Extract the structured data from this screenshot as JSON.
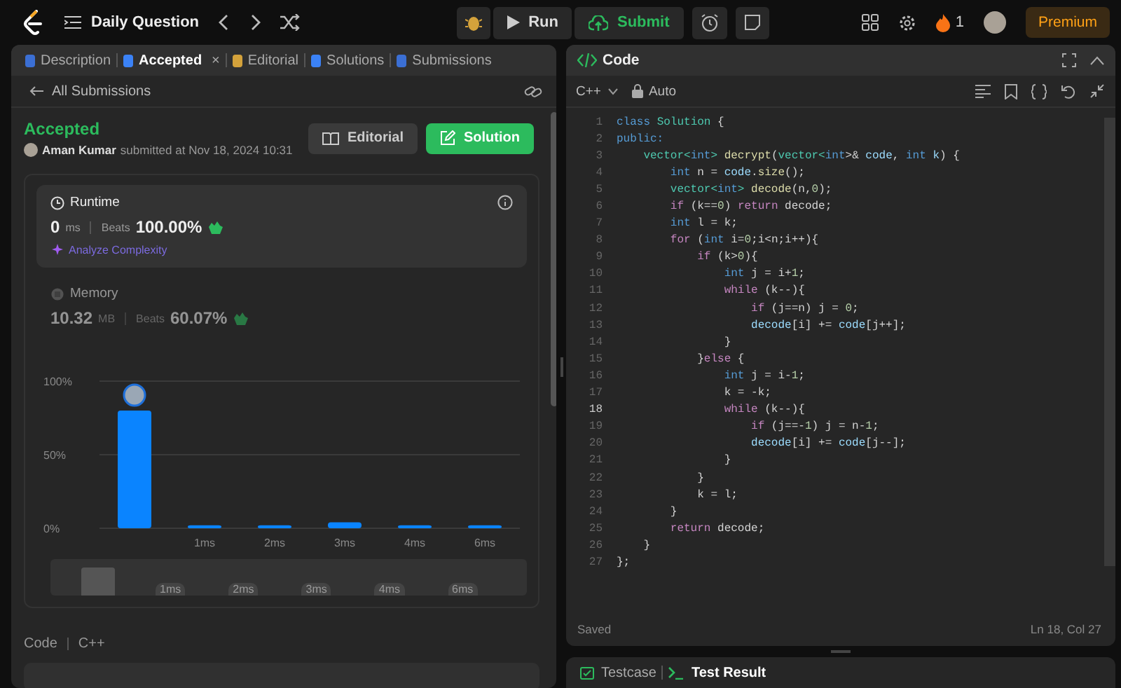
{
  "top_bar": {
    "nav_title": "Daily Question",
    "run": "Run",
    "submit": "Submit",
    "streak": "1",
    "premium": "Premium"
  },
  "left_tabs": [
    {
      "label": "Description",
      "selected": false,
      "closable": false,
      "color": "#3b6fd4"
    },
    {
      "label": "Accepted",
      "selected": true,
      "closable": true,
      "close": "×",
      "color": "#3b82f6"
    },
    {
      "label": "Editorial",
      "selected": false,
      "closable": false,
      "color": "#d4a23b"
    },
    {
      "label": "Solutions",
      "selected": false,
      "closable": false,
      "color": "#3b82f6"
    },
    {
      "label": "Submissions",
      "selected": false,
      "closable": false,
      "color": "#3b6fd4"
    }
  ],
  "back_link": "All Submissions",
  "submission": {
    "status": "Accepted",
    "author": "Aman Kumar",
    "submitted": "submitted at Nov 18, 2024 10:31",
    "editorial_button": "Editorial",
    "solution_button": "Solution"
  },
  "metrics": [
    {
      "kind": "runtime",
      "title": "Runtime",
      "selected": true,
      "value": "0",
      "unit": "ms",
      "beats_label": "Beats",
      "beats": "100.00%",
      "analyze": "Analyze Complexity"
    },
    {
      "kind": "memory",
      "title": "Memory",
      "selected": false,
      "value": "10.32",
      "unit": "MB",
      "beats_label": "Beats",
      "beats": "60.07%"
    }
  ],
  "chart_data": {
    "type": "bar",
    "categories": [
      null,
      "1ms",
      "2ms",
      "3ms",
      "4ms",
      "6ms"
    ],
    "values": [
      80,
      2,
      2,
      4,
      2,
      2
    ],
    "ylim": [
      0,
      100
    ],
    "yticks": [
      {
        "value": 0,
        "label": "0%"
      },
      {
        "value": 50,
        "label": "50%"
      },
      {
        "value": 100,
        "label": "100%"
      }
    ]
  },
  "overview_labels": [
    "1ms",
    "2ms",
    "3ms",
    "4ms",
    "6ms"
  ],
  "code_section": {
    "label": "Code",
    "language": "C++"
  },
  "editor": {
    "title": "Code",
    "language": "C++",
    "mode": "Auto",
    "status": "Saved",
    "cursor": "Ln 18, Col 27",
    "lines": [
      {
        "n": "1",
        "current": false,
        "seg": [
          {
            "text": "class ",
            "kind": "kw"
          },
          {
            "text": "Solution",
            "kind": "type"
          },
          {
            "text": " {",
            "kind": "p"
          }
        ]
      },
      {
        "n": "2",
        "current": false,
        "seg": [
          {
            "text": "public:",
            "kind": "kw"
          }
        ]
      },
      {
        "n": "3",
        "current": false,
        "seg": [
          {
            "text": "    vector<",
            "kind": "type"
          },
          {
            "text": "int",
            "kind": "kw"
          },
          {
            "text": "> ",
            "kind": "type"
          },
          {
            "text": "decrypt",
            "kind": "fn"
          },
          {
            "text": "(",
            "kind": "p"
          },
          {
            "text": "vector<",
            "kind": "type"
          },
          {
            "text": "int",
            "kind": "kw"
          },
          {
            "text": ">& ",
            "kind": "p"
          },
          {
            "text": "code",
            "kind": "var"
          },
          {
            "text": ", ",
            "kind": "p"
          },
          {
            "text": "int ",
            "kind": "kw"
          },
          {
            "text": "k",
            "kind": "var"
          },
          {
            "text": ") {",
            "kind": "p"
          }
        ]
      },
      {
        "n": "4",
        "current": false,
        "seg": [
          {
            "text": "        int ",
            "kind": "kw"
          },
          {
            "text": "n = ",
            "kind": "p"
          },
          {
            "text": "code",
            "kind": "var"
          },
          {
            "text": ".",
            "kind": "p"
          },
          {
            "text": "size",
            "kind": "fn"
          },
          {
            "text": "();",
            "kind": "p"
          }
        ]
      },
      {
        "n": "5",
        "current": false,
        "seg": [
          {
            "text": "        vector<",
            "kind": "type"
          },
          {
            "text": "int",
            "kind": "kw"
          },
          {
            "text": "> ",
            "kind": "type"
          },
          {
            "text": "decode",
            "kind": "fn"
          },
          {
            "text": "(n,",
            "kind": "p"
          },
          {
            "text": "0",
            "kind": "num"
          },
          {
            "text": ");",
            "kind": "p"
          }
        ]
      },
      {
        "n": "6",
        "current": false,
        "seg": [
          {
            "text": "        if ",
            "kind": "ctl"
          },
          {
            "text": "(k==",
            "kind": "p"
          },
          {
            "text": "0",
            "kind": "num"
          },
          {
            "text": ") ",
            "kind": "p"
          },
          {
            "text": "return ",
            "kind": "ctl"
          },
          {
            "text": "decode;",
            "kind": "p"
          }
        ]
      },
      {
        "n": "7",
        "current": false,
        "seg": [
          {
            "text": "        int ",
            "kind": "kw"
          },
          {
            "text": "l = k;",
            "kind": "p"
          }
        ]
      },
      {
        "n": "8",
        "current": false,
        "seg": [
          {
            "text": "        for ",
            "kind": "ctl"
          },
          {
            "text": "(",
            "kind": "p"
          },
          {
            "text": "int ",
            "kind": "kw"
          },
          {
            "text": "i=",
            "kind": "p"
          },
          {
            "text": "0",
            "kind": "num"
          },
          {
            "text": ";i<n;i++){",
            "kind": "p"
          }
        ]
      },
      {
        "n": "9",
        "current": false,
        "seg": [
          {
            "text": "            if ",
            "kind": "ctl"
          },
          {
            "text": "(k>",
            "kind": "p"
          },
          {
            "text": "0",
            "kind": "num"
          },
          {
            "text": "){",
            "kind": "p"
          }
        ]
      },
      {
        "n": "10",
        "current": false,
        "seg": [
          {
            "text": "                int ",
            "kind": "kw"
          },
          {
            "text": "j = i+",
            "kind": "p"
          },
          {
            "text": "1",
            "kind": "num"
          },
          {
            "text": ";",
            "kind": "p"
          }
        ]
      },
      {
        "n": "11",
        "current": false,
        "seg": [
          {
            "text": "                while ",
            "kind": "ctl"
          },
          {
            "text": "(k--){",
            "kind": "p"
          }
        ]
      },
      {
        "n": "12",
        "current": false,
        "seg": [
          {
            "text": "                    if ",
            "kind": "ctl"
          },
          {
            "text": "(j==n) j = ",
            "kind": "p"
          },
          {
            "text": "0",
            "kind": "num"
          },
          {
            "text": ";",
            "kind": "p"
          }
        ]
      },
      {
        "n": "13",
        "current": false,
        "seg": [
          {
            "text": "                    decode",
            "kind": "var"
          },
          {
            "text": "[i] += ",
            "kind": "p"
          },
          {
            "text": "code",
            "kind": "var"
          },
          {
            "text": "[j++];",
            "kind": "p"
          }
        ]
      },
      {
        "n": "14",
        "current": false,
        "seg": [
          {
            "text": "                }",
            "kind": "p"
          }
        ]
      },
      {
        "n": "15",
        "current": false,
        "seg": [
          {
            "text": "            }",
            "kind": "p"
          },
          {
            "text": "else",
            "kind": "ctl"
          },
          {
            "text": " {",
            "kind": "p"
          }
        ]
      },
      {
        "n": "16",
        "current": false,
        "seg": [
          {
            "text": "                int ",
            "kind": "kw"
          },
          {
            "text": "j = i-",
            "kind": "p"
          },
          {
            "text": "1",
            "kind": "num"
          },
          {
            "text": ";",
            "kind": "p"
          }
        ]
      },
      {
        "n": "17",
        "current": false,
        "seg": [
          {
            "text": "                k = -k;",
            "kind": "p"
          }
        ]
      },
      {
        "n": "18",
        "current": true,
        "seg": [
          {
            "text": "                while ",
            "kind": "ctl"
          },
          {
            "text": "(k--){",
            "kind": "p"
          }
        ]
      },
      {
        "n": "19",
        "current": false,
        "seg": [
          {
            "text": "                    if ",
            "kind": "ctl"
          },
          {
            "text": "(j==-",
            "kind": "p"
          },
          {
            "text": "1",
            "kind": "num"
          },
          {
            "text": ") j = n-",
            "kind": "p"
          },
          {
            "text": "1",
            "kind": "num"
          },
          {
            "text": ";",
            "kind": "p"
          }
        ]
      },
      {
        "n": "20",
        "current": false,
        "seg": [
          {
            "text": "                    decode",
            "kind": "var"
          },
          {
            "text": "[i] += ",
            "kind": "p"
          },
          {
            "text": "code",
            "kind": "var"
          },
          {
            "text": "[j--];",
            "kind": "p"
          }
        ]
      },
      {
        "n": "21",
        "current": false,
        "seg": [
          {
            "text": "                }",
            "kind": "p"
          }
        ]
      },
      {
        "n": "22",
        "current": false,
        "seg": [
          {
            "text": "            }",
            "kind": "p"
          }
        ]
      },
      {
        "n": "23",
        "current": false,
        "seg": [
          {
            "text": "            k = l;",
            "kind": "p"
          }
        ]
      },
      {
        "n": "24",
        "current": false,
        "seg": [
          {
            "text": "        }",
            "kind": "p"
          }
        ]
      },
      {
        "n": "25",
        "current": false,
        "seg": [
          {
            "text": "        return ",
            "kind": "ctl"
          },
          {
            "text": "decode;",
            "kind": "p"
          }
        ]
      },
      {
        "n": "26",
        "current": false,
        "seg": [
          {
            "text": "    }",
            "kind": "p"
          }
        ]
      },
      {
        "n": "27",
        "current": false,
        "seg": [
          {
            "text": "};",
            "kind": "p"
          }
        ]
      }
    ]
  },
  "bottom_tabs": [
    {
      "label": "Testcase",
      "selected": false
    },
    {
      "label": "Test Result",
      "selected": true
    }
  ]
}
